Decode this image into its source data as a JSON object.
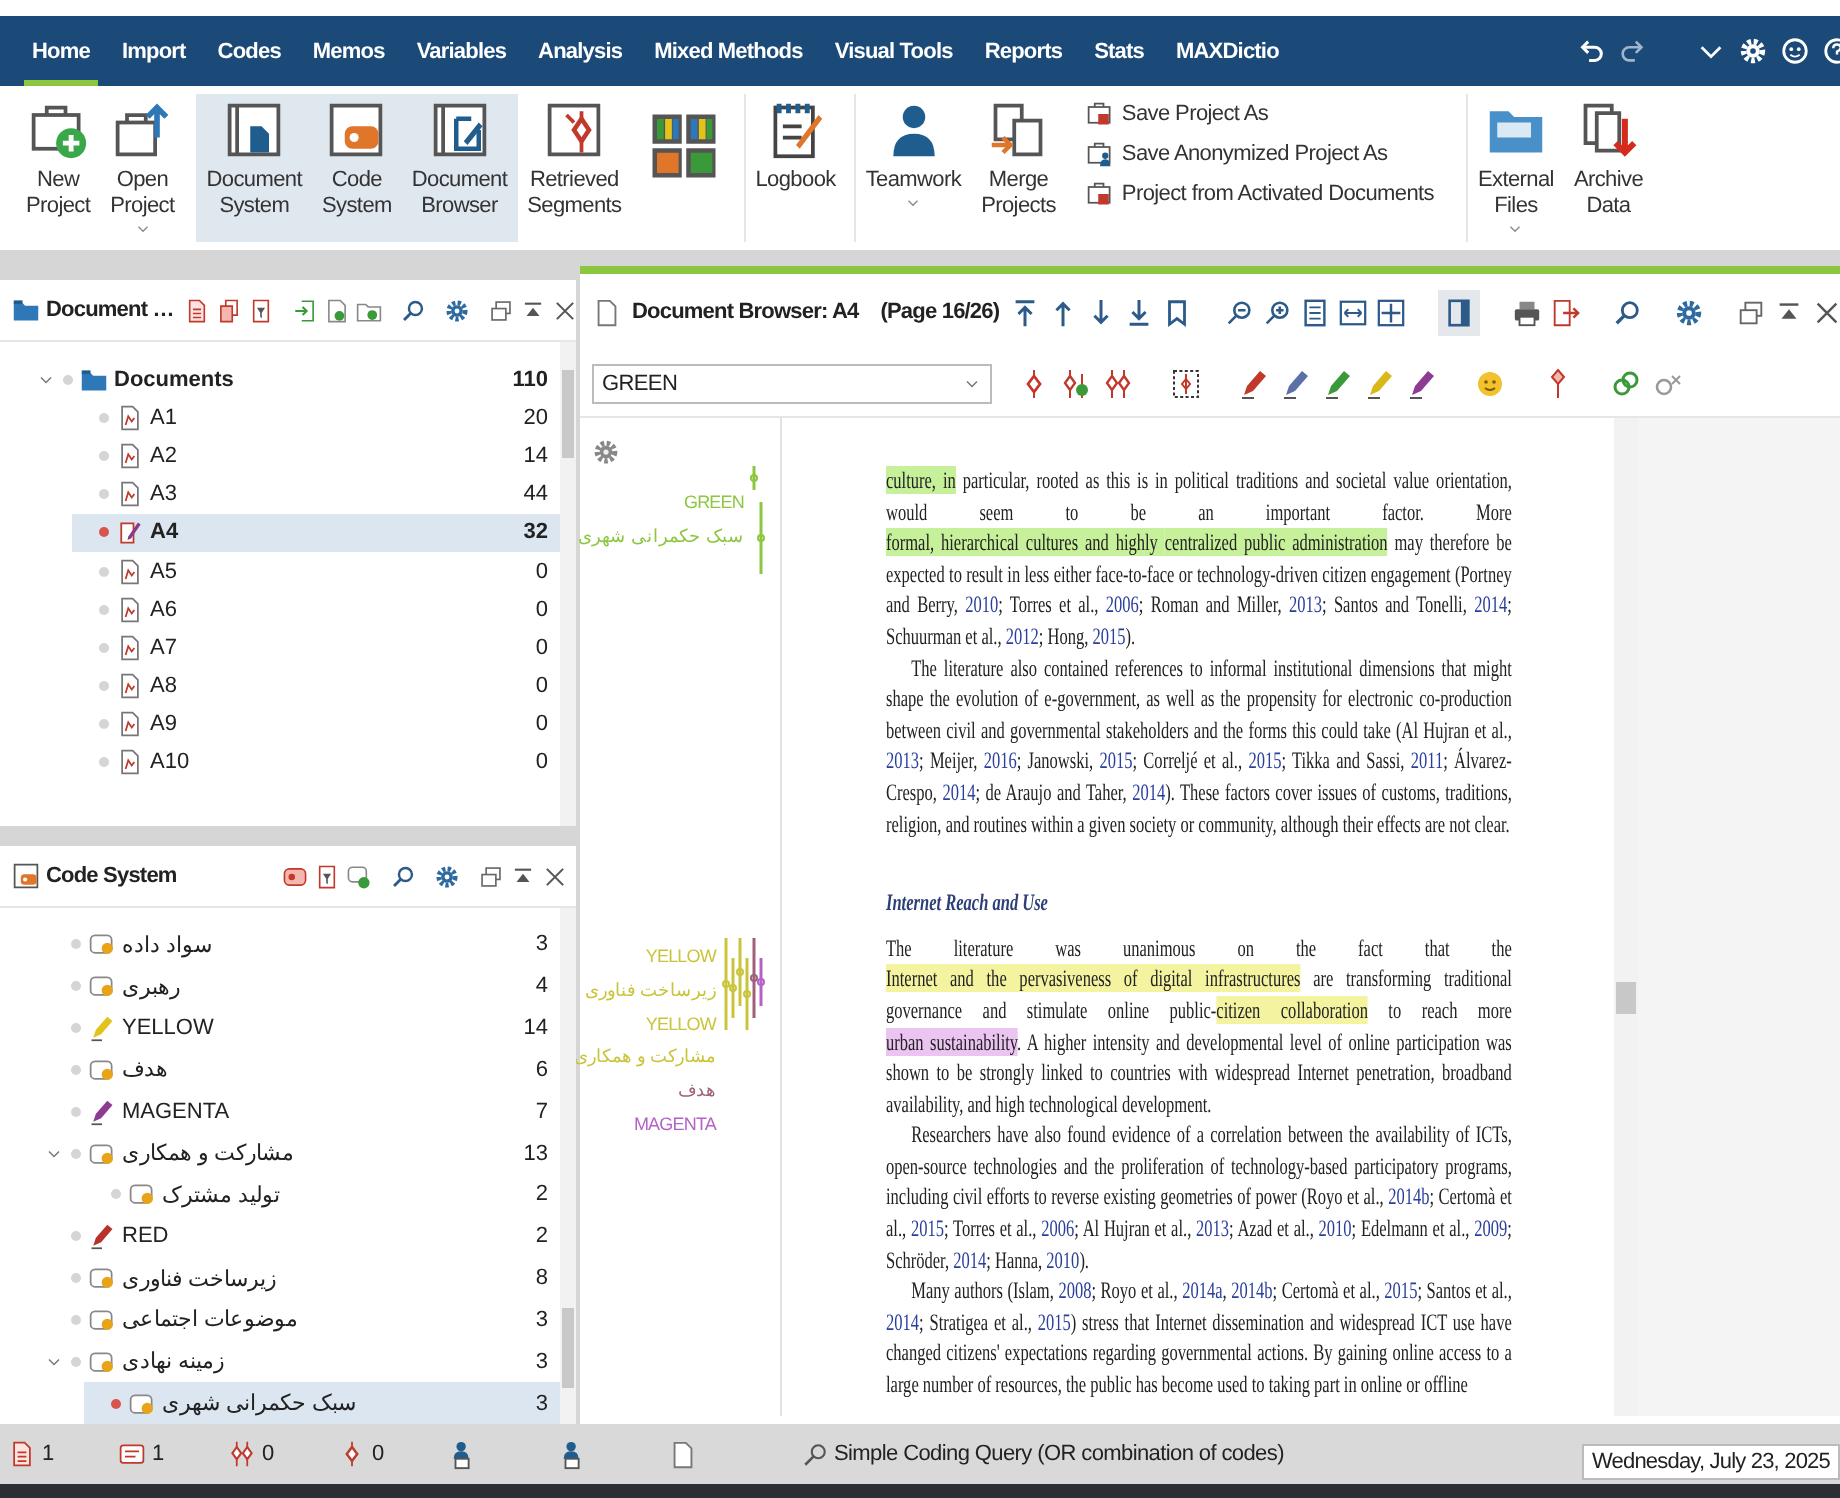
{
  "menu_tabs": [
    {
      "label": "Home",
      "selected": true
    },
    {
      "label": "Import",
      "selected": false
    },
    {
      "label": "Codes",
      "selected": false
    },
    {
      "label": "Memos",
      "selected": false
    },
    {
      "label": "Variables",
      "selected": false
    },
    {
      "label": "Analysis",
      "selected": false
    },
    {
      "label": "Mixed Methods",
      "selected": false
    },
    {
      "label": "Visual Tools",
      "selected": false
    },
    {
      "label": "Reports",
      "selected": false
    },
    {
      "label": "Stats",
      "selected": false
    },
    {
      "label": "MAXDictio",
      "selected": false
    }
  ],
  "ribbon": [
    {
      "kind": "large",
      "label": "New Project",
      "on": false
    },
    {
      "kind": "large",
      "label": "Open Project",
      "on": false,
      "dropdown": true
    },
    {
      "kind": "large",
      "label": "Document System",
      "on": true
    },
    {
      "kind": "large",
      "label": "Code System",
      "on": true
    },
    {
      "kind": "large",
      "label": "Document Browser",
      "on": true
    },
    {
      "kind": "large",
      "label": "Retrieved Segments",
      "on": false
    },
    {
      "kind": "grid"
    },
    {
      "kind": "large",
      "label": "Logbook",
      "on": false
    },
    {
      "kind": "large",
      "label": "Teamwork",
      "on": false,
      "dropdown": true
    },
    {
      "kind": "large",
      "label": "Merge Projects",
      "on": false
    },
    {
      "kind": "stack",
      "items": [
        {
          "label": "Save Project As"
        },
        {
          "label": "Save Anonymized Project As"
        },
        {
          "label": "Project from Activated Documents"
        }
      ]
    },
    {
      "kind": "large",
      "label": "External Files",
      "on": false,
      "dropdown": true
    },
    {
      "kind": "large",
      "label": "Archive Data",
      "on": false
    }
  ],
  "document_system": {
    "title": "Document …",
    "tree": [
      {
        "label": "Documents",
        "count": "110",
        "expanded": true,
        "selected": false,
        "children": [
          {
            "label": "A1",
            "count": "20",
            "selected": false
          },
          {
            "label": "A2",
            "count": "14",
            "selected": false
          },
          {
            "label": "A3",
            "count": "44",
            "selected": false
          },
          {
            "label": "A4",
            "count": "32",
            "selected": true
          },
          {
            "label": "A5",
            "count": "0",
            "selected": false
          },
          {
            "label": "A6",
            "count": "0",
            "selected": false
          },
          {
            "label": "A7",
            "count": "0",
            "selected": false
          },
          {
            "label": "A8",
            "count": "0",
            "selected": false
          },
          {
            "label": "A9",
            "count": "0",
            "selected": false
          },
          {
            "label": "A10",
            "count": "0",
            "selected": false
          }
        ]
      }
    ]
  },
  "code_system": {
    "title": "Code System",
    "tree": [
      {
        "kind": "code",
        "label": "سواد داده",
        "count": "3",
        "selected": false
      },
      {
        "kind": "code",
        "label": "رهبری",
        "count": "4",
        "selected": false
      },
      {
        "kind": "color-code",
        "label": "YELLOW",
        "count": "14",
        "color": "#e3c21a",
        "selected": false
      },
      {
        "kind": "code",
        "label": "هدف",
        "count": "6",
        "selected": false
      },
      {
        "kind": "color-code",
        "label": "MAGENTA",
        "count": "7",
        "color": "#8e3b96",
        "selected": false
      },
      {
        "kind": "code",
        "label": "مشارکت و همکاری",
        "count": "13",
        "expanded": true,
        "selected": false,
        "children": [
          {
            "kind": "code",
            "label": "تولید مشترک",
            "count": "2",
            "selected": false
          }
        ]
      },
      {
        "kind": "color-code",
        "label": "RED",
        "count": "2",
        "color": "#b8322a",
        "selected": false
      },
      {
        "kind": "code",
        "label": "زیرساخت فناوری",
        "count": "8",
        "selected": false
      },
      {
        "kind": "code",
        "label": "موضوعات اجتماعی",
        "count": "3",
        "selected": false
      },
      {
        "kind": "code",
        "label": "زمینه نهادی",
        "count": "3",
        "expanded": true,
        "selected": false,
        "children": [
          {
            "kind": "code",
            "label": "سبک حکمرانی شهری",
            "count": "3",
            "selected": true
          }
        ]
      }
    ]
  },
  "document_browser": {
    "title": "Document Browser: A4",
    "page": "(Page 16/26)",
    "code_field": {
      "value": "GREEN"
    },
    "margin": [
      {
        "labels": [
          {
            "text": "GREEN",
            "color": "#8dc63f"
          },
          {
            "text": "سبک حکمرانی شهری",
            "color": "#8dc63f"
          }
        ]
      },
      {
        "labels": [
          {
            "text": "YELLOW",
            "color": "#c9c43a"
          },
          {
            "text": "زیرساخت فناوری",
            "color": "#c9c43a"
          },
          {
            "text": "YELLOW",
            "color": "#c9c43a"
          },
          {
            "text": "مشارکت و همکاری",
            "color": "#c9c43a"
          },
          {
            "text": "هدف",
            "color": "#a0607a"
          },
          {
            "text": "MAGENTA",
            "color": "#b363c8"
          }
        ]
      }
    ],
    "paragraphs": [
      {
        "kind": "para",
        "indent": false,
        "runs": [
          {
            "kind": "coded",
            "color": "#c6f09a",
            "text": "culture, in"
          },
          {
            "kind": "text",
            "text": " particular, rooted as this is in political traditions and societal value orientation, would seem to be an important factor. More "
          },
          {
            "kind": "coded",
            "color": "#c6f09a",
            "text": "formal, hierarchical cultures and highly "
          },
          {
            "kind": "coded",
            "color": "#c6f09a",
            "text": "centralized public administration"
          },
          {
            "kind": "text",
            "text": " may therefore be expected to result in less either face-to-face or technology-driven citizen engagement (Portney and Berry, "
          },
          {
            "kind": "cite",
            "text": "2010"
          },
          {
            "kind": "text",
            "text": "; Torres et al., "
          },
          {
            "kind": "cite",
            "text": "2006"
          },
          {
            "kind": "text",
            "text": "; Roman and Miller, "
          },
          {
            "kind": "cite",
            "text": "2013"
          },
          {
            "kind": "text",
            "text": "; Santos and Tonelli, "
          },
          {
            "kind": "cite",
            "text": "2014"
          },
          {
            "kind": "text",
            "text": "; Schuurman et al., "
          },
          {
            "kind": "cite",
            "text": "2012"
          },
          {
            "kind": "text",
            "text": "; Hong, "
          },
          {
            "kind": "cite",
            "text": "2015"
          },
          {
            "kind": "text",
            "text": ")."
          }
        ]
      },
      {
        "kind": "para",
        "indent": true,
        "runs": [
          {
            "kind": "text",
            "text": "The literature also contained references to informal institutional dimensions that might shape the evolution of e-government, as well as the propensity for electronic co-production between civil and governmental stakeholders and the forms this could take (Al Hujran et al., "
          },
          {
            "kind": "cite",
            "text": "2013"
          },
          {
            "kind": "text",
            "text": "; Meijer, "
          },
          {
            "kind": "cite",
            "text": "2016"
          },
          {
            "kind": "text",
            "text": "; Janowski, "
          },
          {
            "kind": "cite",
            "text": "2015"
          },
          {
            "kind": "text",
            "text": "; Correljé et al., "
          },
          {
            "kind": "cite",
            "text": "2015"
          },
          {
            "kind": "text",
            "text": "; Tikka and Sassi, "
          },
          {
            "kind": "cite",
            "text": "2011"
          },
          {
            "kind": "text",
            "text": "; Álvarez-Crespo, "
          },
          {
            "kind": "cite",
            "text": "2014"
          },
          {
            "kind": "text",
            "text": "; de Araujo and Taher, "
          },
          {
            "kind": "cite",
            "text": "2014"
          },
          {
            "kind": "text",
            "text": "). These factors cover issues of customs, traditions, religion, and routines within a given society or community, although their effects are not clear."
          }
        ]
      },
      {
        "kind": "heading",
        "text": "Internet Reach and Use"
      },
      {
        "kind": "para",
        "indent": false,
        "runs": [
          {
            "kind": "text",
            "text": "The literature was unanimous on the fact that the "
          },
          {
            "kind": "coded",
            "color": "#f3f3a0",
            "text": "Internet and the pervasiveness of digital "
          },
          {
            "kind": "coded",
            "color": "#f3f3a0",
            "text": "infrastructures"
          },
          {
            "kind": "text",
            "text": " are transforming traditional governance and stimulate online public-"
          },
          {
            "kind": "coded",
            "color": "#f3f3a0",
            "text": "citizen collaboration"
          },
          {
            "kind": "text",
            "text": " to reach more "
          },
          {
            "kind": "coded",
            "color": "#ecc4f2",
            "text": "urban sustainability"
          },
          {
            "kind": "text",
            "text": ". A higher intensity and developmental level of online participation was shown to be strongly linked to countries with widespread Internet penetration, broadband availability, and high technological development."
          }
        ]
      },
      {
        "kind": "para",
        "indent": true,
        "runs": [
          {
            "kind": "text",
            "text": "Researchers have also found evidence of a correlation between the availability of ICTs, open-source technologies and the proliferation of technology-based participatory programs, including civil efforts to reverse existing geometries of power (Royo et al., "
          },
          {
            "kind": "cite",
            "text": "2014b"
          },
          {
            "kind": "text",
            "text": "; Certomà et al., "
          },
          {
            "kind": "cite",
            "text": "2015"
          },
          {
            "kind": "text",
            "text": "; Torres et al., "
          },
          {
            "kind": "cite",
            "text": "2006"
          },
          {
            "kind": "text",
            "text": "; Al Hujran et al., "
          },
          {
            "kind": "cite",
            "text": "2013"
          },
          {
            "kind": "text",
            "text": "; Azad et al., "
          },
          {
            "kind": "cite",
            "text": "2010"
          },
          {
            "kind": "text",
            "text": "; Edelmann et al., "
          },
          {
            "kind": "cite",
            "text": "2009"
          },
          {
            "kind": "text",
            "text": "; Schröder, "
          },
          {
            "kind": "cite",
            "text": "2014"
          },
          {
            "kind": "text",
            "text": "; Hanna, "
          },
          {
            "kind": "cite",
            "text": "2010"
          },
          {
            "kind": "text",
            "text": ")."
          }
        ]
      },
      {
        "kind": "para",
        "indent": true,
        "runs": [
          {
            "kind": "text",
            "text": "Many authors (Islam, "
          },
          {
            "kind": "cite",
            "text": "2008"
          },
          {
            "kind": "text",
            "text": "; Royo et al., "
          },
          {
            "kind": "cite",
            "text": "2014a"
          },
          {
            "kind": "text",
            "text": ", "
          },
          {
            "kind": "cite",
            "text": "2014b"
          },
          {
            "kind": "text",
            "text": "; Certomà et al., "
          },
          {
            "kind": "cite",
            "text": "2015"
          },
          {
            "kind": "text",
            "text": "; Santos et al., "
          },
          {
            "kind": "cite",
            "text": "2014"
          },
          {
            "kind": "text",
            "text": "; Stratigea et al., "
          },
          {
            "kind": "cite",
            "text": "2015"
          },
          {
            "kind": "text",
            "text": ") stress that Internet dissemination and widespread ICT use have changed citizens' expectations regarding governmental actions. By gaining online access to a large number of resources, the public has become used to taking part in online or offline"
          }
        ]
      }
    ]
  },
  "status_bar": {
    "counts": [
      {
        "value": "1"
      },
      {
        "value": "1"
      },
      {
        "value": "0"
      },
      {
        "value": "0"
      }
    ],
    "query": "Simple Coding Query (OR combination of codes)",
    "date": "Wednesday, July 23, 2025"
  }
}
